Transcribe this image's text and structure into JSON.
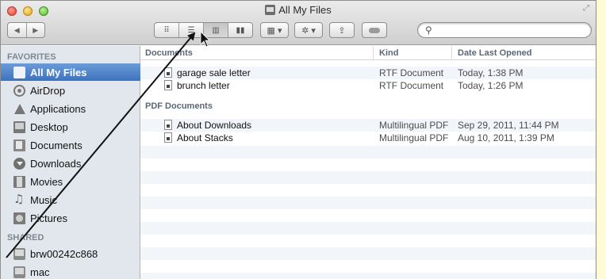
{
  "window": {
    "title": "All My Files"
  },
  "sidebar": {
    "favorites_header": "FAVORITES",
    "shared_header": "SHARED",
    "favorites": [
      {
        "label": "All My Files",
        "icon": "all-my-files-icon"
      },
      {
        "label": "AirDrop",
        "icon": "airdrop-icon"
      },
      {
        "label": "Applications",
        "icon": "applications-icon"
      },
      {
        "label": "Desktop",
        "icon": "desktop-icon"
      },
      {
        "label": "Documents",
        "icon": "documents-icon"
      },
      {
        "label": "Downloads",
        "icon": "downloads-icon"
      },
      {
        "label": "Movies",
        "icon": "movies-icon"
      },
      {
        "label": "Music",
        "icon": "music-icon"
      },
      {
        "label": "Pictures",
        "icon": "pictures-icon"
      }
    ],
    "shared": [
      {
        "label": "brw00242c868",
        "icon": "computer-icon"
      },
      {
        "label": "mac",
        "icon": "computer-icon"
      }
    ]
  },
  "columns": {
    "name": "Documents",
    "kind": "Kind",
    "date": "Date Last Opened"
  },
  "groups": [
    {
      "label": "Documents",
      "files": [
        {
          "name": "garage sale letter",
          "kind": "RTF Document",
          "date": "Today, 1:38 PM"
        },
        {
          "name": "brunch letter",
          "kind": "RTF Document",
          "date": "Today, 1:26 PM"
        }
      ]
    },
    {
      "label": "PDF Documents",
      "files": [
        {
          "name": "About Downloads",
          "kind": "Multilingual PDF",
          "date": "Sep 29, 2011, 11:44 PM"
        },
        {
          "name": "About Stacks",
          "kind": "Multilingual PDF",
          "date": "Aug 10, 2011, 1:39 PM"
        }
      ]
    }
  ],
  "colors": {
    "selection": "#3d72bd",
    "sidebar_bg": "#e2e7ed",
    "page_bg": "#fefbd6"
  }
}
